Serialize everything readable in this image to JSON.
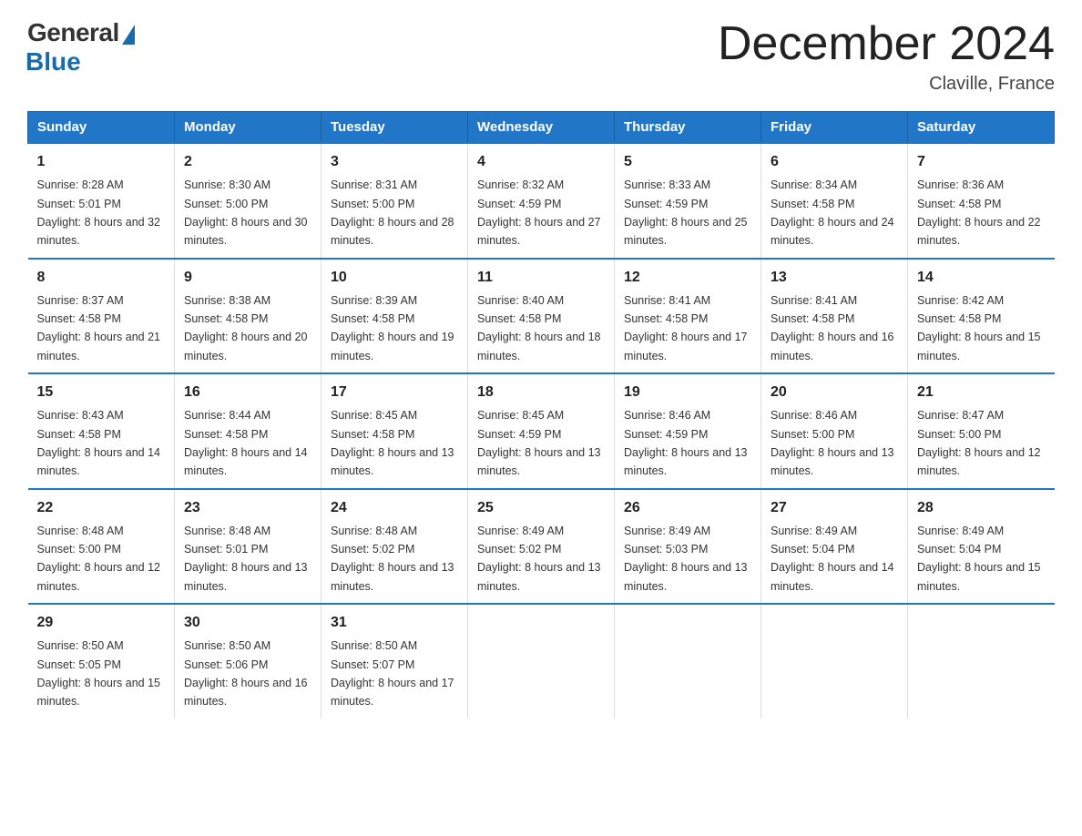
{
  "logo": {
    "general": "General",
    "blue": "Blue"
  },
  "title": "December 2024",
  "location": "Claville, France",
  "days_of_week": [
    "Sunday",
    "Monday",
    "Tuesday",
    "Wednesday",
    "Thursday",
    "Friday",
    "Saturday"
  ],
  "weeks": [
    [
      {
        "num": "1",
        "sunrise": "8:28 AM",
        "sunset": "5:01 PM",
        "daylight": "8 hours and 32 minutes."
      },
      {
        "num": "2",
        "sunrise": "8:30 AM",
        "sunset": "5:00 PM",
        "daylight": "8 hours and 30 minutes."
      },
      {
        "num": "3",
        "sunrise": "8:31 AM",
        "sunset": "5:00 PM",
        "daylight": "8 hours and 28 minutes."
      },
      {
        "num": "4",
        "sunrise": "8:32 AM",
        "sunset": "4:59 PM",
        "daylight": "8 hours and 27 minutes."
      },
      {
        "num": "5",
        "sunrise": "8:33 AM",
        "sunset": "4:59 PM",
        "daylight": "8 hours and 25 minutes."
      },
      {
        "num": "6",
        "sunrise": "8:34 AM",
        "sunset": "4:58 PM",
        "daylight": "8 hours and 24 minutes."
      },
      {
        "num": "7",
        "sunrise": "8:36 AM",
        "sunset": "4:58 PM",
        "daylight": "8 hours and 22 minutes."
      }
    ],
    [
      {
        "num": "8",
        "sunrise": "8:37 AM",
        "sunset": "4:58 PM",
        "daylight": "8 hours and 21 minutes."
      },
      {
        "num": "9",
        "sunrise": "8:38 AM",
        "sunset": "4:58 PM",
        "daylight": "8 hours and 20 minutes."
      },
      {
        "num": "10",
        "sunrise": "8:39 AM",
        "sunset": "4:58 PM",
        "daylight": "8 hours and 19 minutes."
      },
      {
        "num": "11",
        "sunrise": "8:40 AM",
        "sunset": "4:58 PM",
        "daylight": "8 hours and 18 minutes."
      },
      {
        "num": "12",
        "sunrise": "8:41 AM",
        "sunset": "4:58 PM",
        "daylight": "8 hours and 17 minutes."
      },
      {
        "num": "13",
        "sunrise": "8:41 AM",
        "sunset": "4:58 PM",
        "daylight": "8 hours and 16 minutes."
      },
      {
        "num": "14",
        "sunrise": "8:42 AM",
        "sunset": "4:58 PM",
        "daylight": "8 hours and 15 minutes."
      }
    ],
    [
      {
        "num": "15",
        "sunrise": "8:43 AM",
        "sunset": "4:58 PM",
        "daylight": "8 hours and 14 minutes."
      },
      {
        "num": "16",
        "sunrise": "8:44 AM",
        "sunset": "4:58 PM",
        "daylight": "8 hours and 14 minutes."
      },
      {
        "num": "17",
        "sunrise": "8:45 AM",
        "sunset": "4:58 PM",
        "daylight": "8 hours and 13 minutes."
      },
      {
        "num": "18",
        "sunrise": "8:45 AM",
        "sunset": "4:59 PM",
        "daylight": "8 hours and 13 minutes."
      },
      {
        "num": "19",
        "sunrise": "8:46 AM",
        "sunset": "4:59 PM",
        "daylight": "8 hours and 13 minutes."
      },
      {
        "num": "20",
        "sunrise": "8:46 AM",
        "sunset": "5:00 PM",
        "daylight": "8 hours and 13 minutes."
      },
      {
        "num": "21",
        "sunrise": "8:47 AM",
        "sunset": "5:00 PM",
        "daylight": "8 hours and 12 minutes."
      }
    ],
    [
      {
        "num": "22",
        "sunrise": "8:48 AM",
        "sunset": "5:00 PM",
        "daylight": "8 hours and 12 minutes."
      },
      {
        "num": "23",
        "sunrise": "8:48 AM",
        "sunset": "5:01 PM",
        "daylight": "8 hours and 13 minutes."
      },
      {
        "num": "24",
        "sunrise": "8:48 AM",
        "sunset": "5:02 PM",
        "daylight": "8 hours and 13 minutes."
      },
      {
        "num": "25",
        "sunrise": "8:49 AM",
        "sunset": "5:02 PM",
        "daylight": "8 hours and 13 minutes."
      },
      {
        "num": "26",
        "sunrise": "8:49 AM",
        "sunset": "5:03 PM",
        "daylight": "8 hours and 13 minutes."
      },
      {
        "num": "27",
        "sunrise": "8:49 AM",
        "sunset": "5:04 PM",
        "daylight": "8 hours and 14 minutes."
      },
      {
        "num": "28",
        "sunrise": "8:49 AM",
        "sunset": "5:04 PM",
        "daylight": "8 hours and 15 minutes."
      }
    ],
    [
      {
        "num": "29",
        "sunrise": "8:50 AM",
        "sunset": "5:05 PM",
        "daylight": "8 hours and 15 minutes."
      },
      {
        "num": "30",
        "sunrise": "8:50 AM",
        "sunset": "5:06 PM",
        "daylight": "8 hours and 16 minutes."
      },
      {
        "num": "31",
        "sunrise": "8:50 AM",
        "sunset": "5:07 PM",
        "daylight": "8 hours and 17 minutes."
      },
      null,
      null,
      null,
      null
    ]
  ],
  "labels": {
    "sunrise": "Sunrise:",
    "sunset": "Sunset:",
    "daylight": "Daylight:"
  }
}
